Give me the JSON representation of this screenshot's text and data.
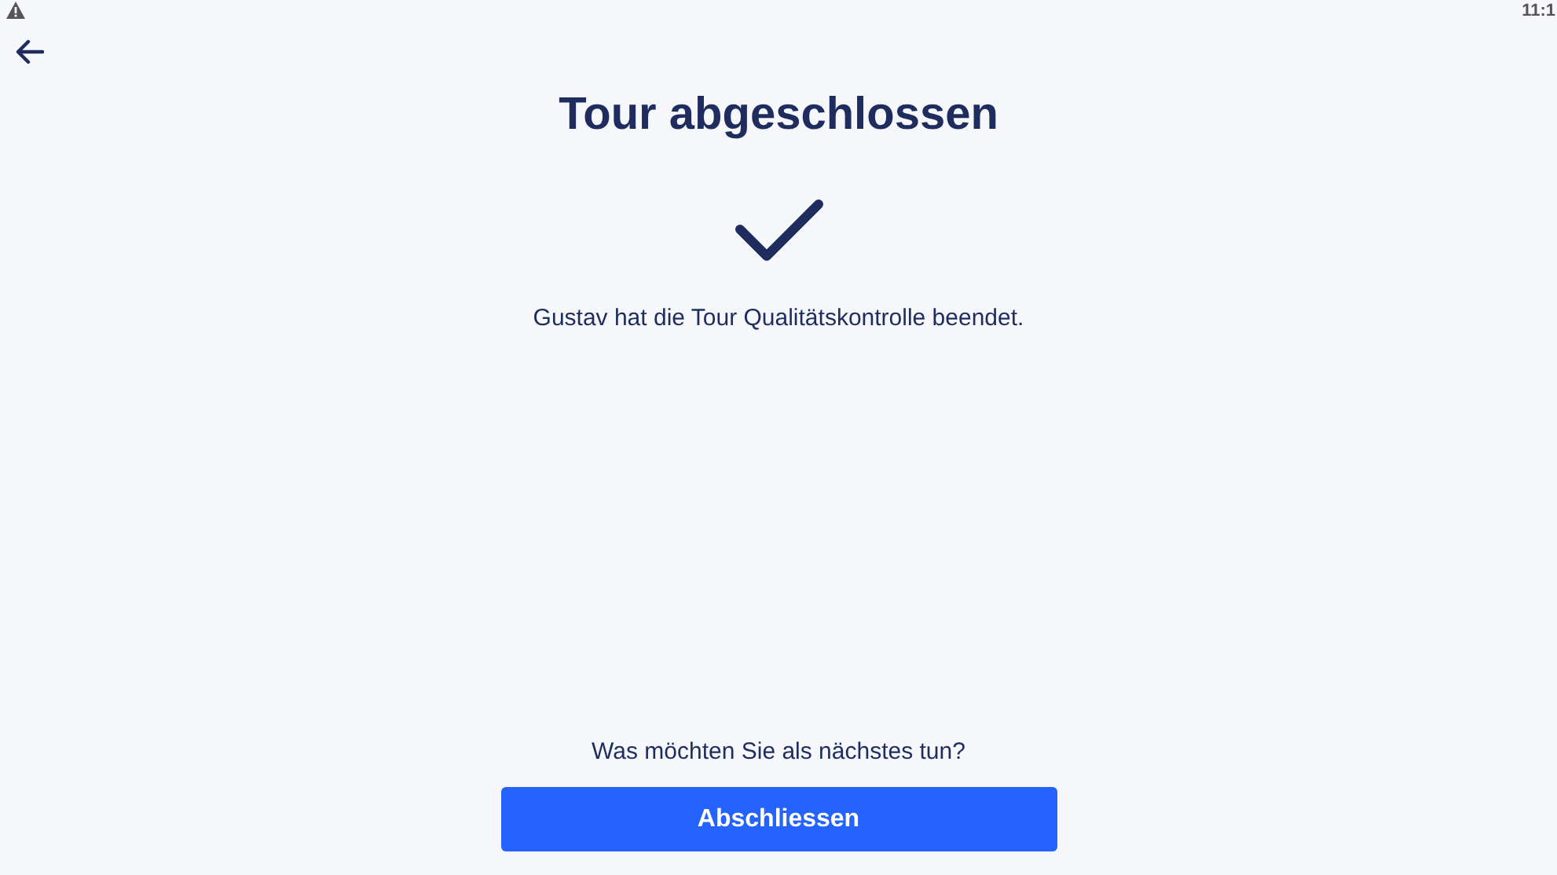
{
  "status_bar": {
    "time": "11:1"
  },
  "title": "Tour abgeschlossen",
  "message": "Gustav hat die Tour Qualitätskontrolle beendet.",
  "question": "Was möchten Sie als nächstes tun?",
  "buttons": [
    {
      "label": "Abschliessen",
      "kind": "primary"
    }
  ]
}
